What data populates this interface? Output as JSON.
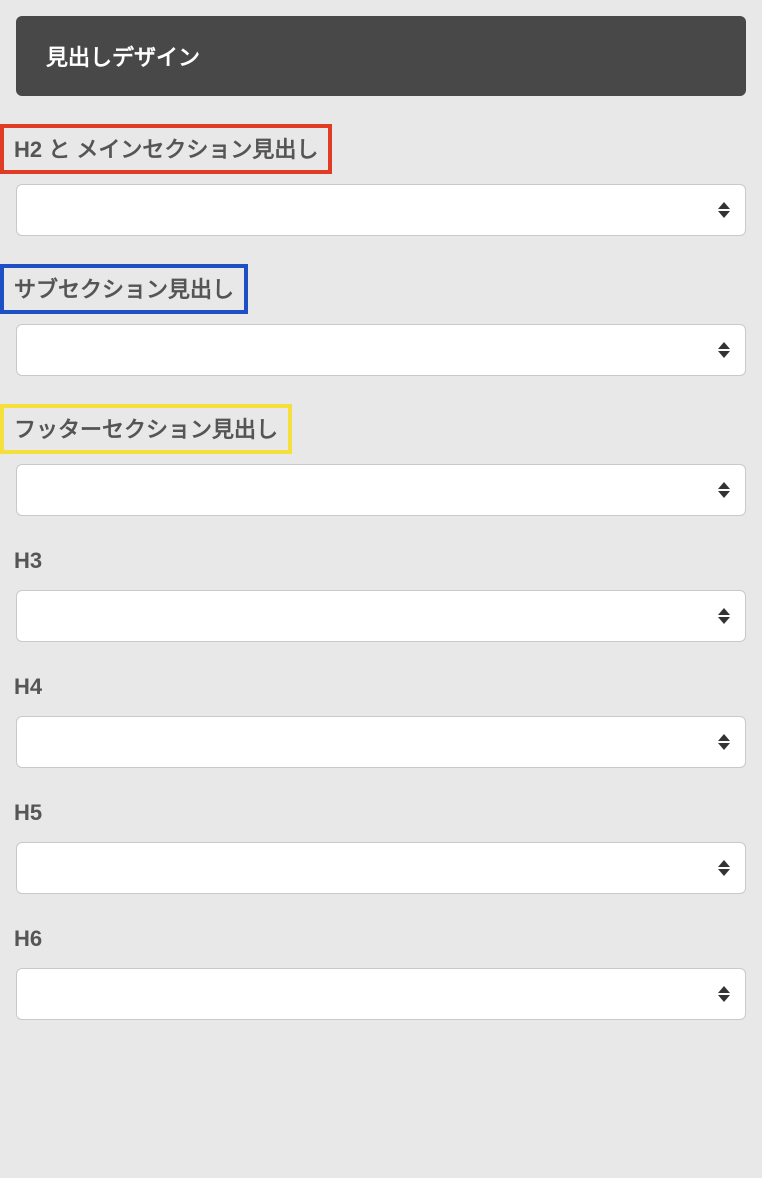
{
  "panel": {
    "title": "見出しデザイン"
  },
  "fields": {
    "h2_main": {
      "label": "H2 と メインセクション見出し",
      "value": "",
      "highlight_color": "#e03b24"
    },
    "sub_section": {
      "label": "サブセクション見出し",
      "value": "",
      "highlight_color": "#1f4fc5"
    },
    "footer_section": {
      "label": "フッターセクション見出し",
      "value": "",
      "highlight_color": "#f5df3d"
    },
    "h3": {
      "label": "H3",
      "value": ""
    },
    "h4": {
      "label": "H4",
      "value": ""
    },
    "h5": {
      "label": "H5",
      "value": ""
    },
    "h6": {
      "label": "H6",
      "value": ""
    }
  }
}
